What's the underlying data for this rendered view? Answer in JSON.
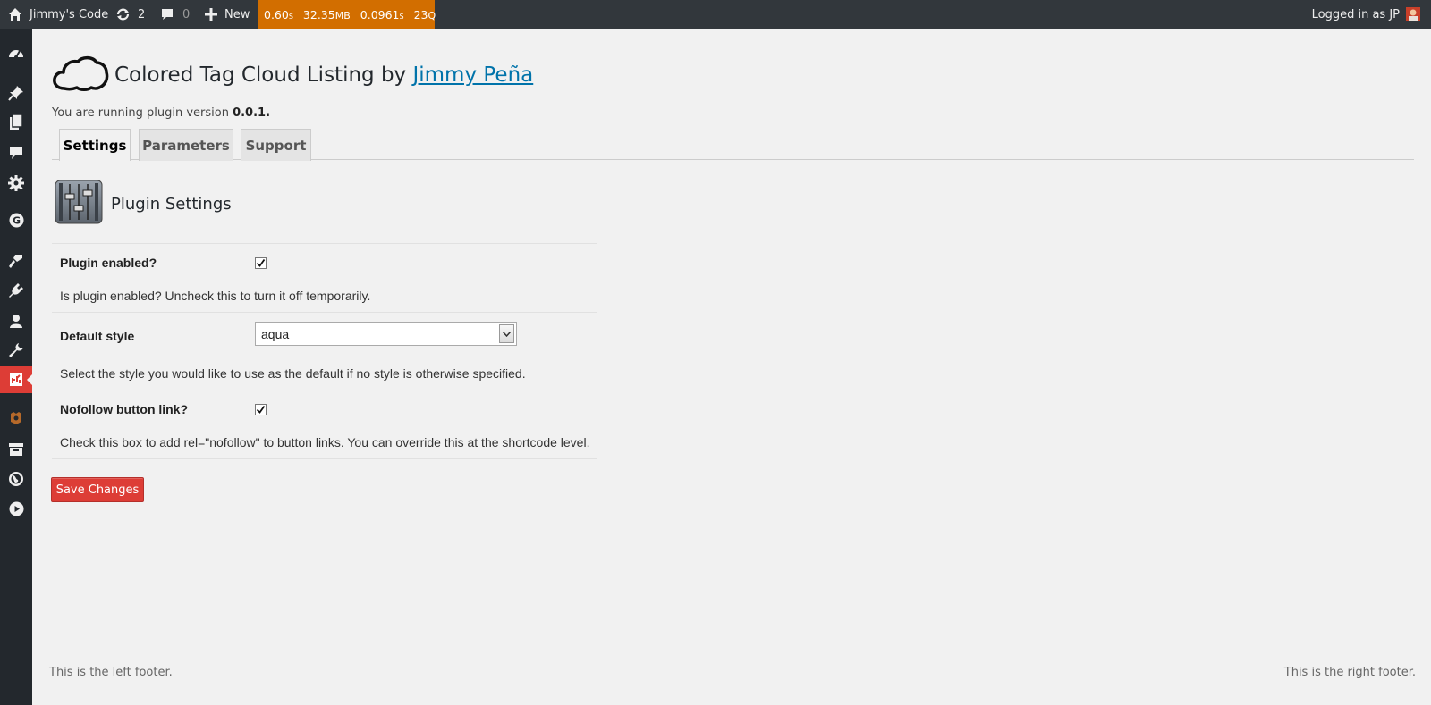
{
  "adminbar": {
    "site_name": "Jimmy's Code",
    "updates_count": "2",
    "comments_count": "0",
    "new_label": "New",
    "perf": {
      "time_num": "0.60",
      "time_unit": "s",
      "memory_num": "32.35",
      "memory_unit": "MB",
      "query_time_num": "0.0961",
      "query_time_unit": "s",
      "queries_num": "23",
      "queries_unit": "Q"
    },
    "logged_in": "Logged in as JP"
  },
  "sidebar": {
    "icons": [
      "dashboard-icon",
      "posts-pin-icon",
      "pages-icon",
      "comments-icon",
      "settings-gear-icon",
      "g-plugin-icon",
      "appearance-brush-icon",
      "plugins-icon",
      "users-icon",
      "tools-wrench-icon",
      "colored-tag-cloud-icon",
      "plugin-badge-icon",
      "archive-icon",
      "globe-icon",
      "play-icon"
    ],
    "active_color": "#dd3d36"
  },
  "page": {
    "title_prefix": "Colored Tag Cloud Listing by ",
    "author_link": "Jimmy Peña",
    "version_prefix": "You are running plugin version ",
    "version": "0.0.1",
    "version_suffix": ".",
    "tabs": [
      {
        "label": "Settings",
        "active": true
      },
      {
        "label": "Parameters",
        "active": false
      },
      {
        "label": "Support",
        "active": false
      }
    ],
    "settings_heading": "Plugin Settings"
  },
  "form": {
    "enabled": {
      "label": "Plugin enabled?",
      "checked": true,
      "description": "Is plugin enabled? Uncheck this to turn it off temporarily."
    },
    "default_style": {
      "label": "Default style",
      "value": "aqua",
      "description": "Select the style you would like to use as the default if no style is otherwise specified."
    },
    "nofollow": {
      "label": "Nofollow button link?",
      "checked": true,
      "description": "Check this box to add rel=\"nofollow\" to button links. You can override this at the shortcode level."
    },
    "save_label": "Save Changes"
  },
  "footer": {
    "left": "This is the left footer.",
    "right": "This is the right footer."
  },
  "colors": {
    "adminbar_bg": "#32373c",
    "perf_bg": "#d26e00",
    "sidebar_bg": "#23282d",
    "accent_red": "#dd3d36",
    "link_blue": "#0073aa"
  }
}
